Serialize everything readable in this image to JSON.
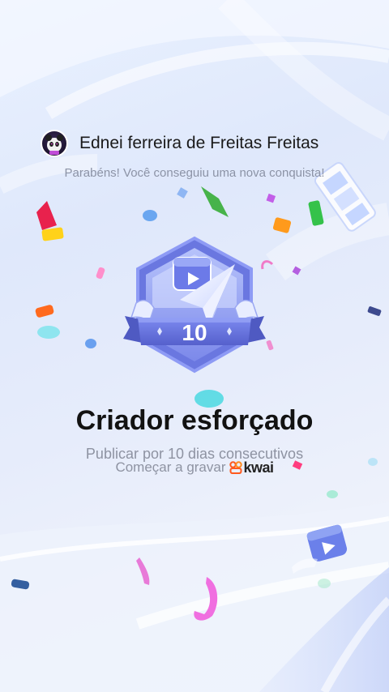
{
  "header": {
    "avatar_icon": "panda-avatar-icon",
    "username": "Ednei ferreira de Freitas Freitas"
  },
  "message": {
    "congrats": "Parabéns! Você conseguiu uma nova conquista!"
  },
  "badge": {
    "number": "10",
    "icon": "paper-plane-video-badge-icon"
  },
  "achievement": {
    "title": "Criador esforçado",
    "description": "Publicar por 10 dias consecutivos",
    "cta": "Começar a gravar",
    "brand": "kwai"
  },
  "colors": {
    "accent": "#6a76e0",
    "badge_dark": "#5a63c9",
    "brand_orange": "#ff5a1e"
  }
}
